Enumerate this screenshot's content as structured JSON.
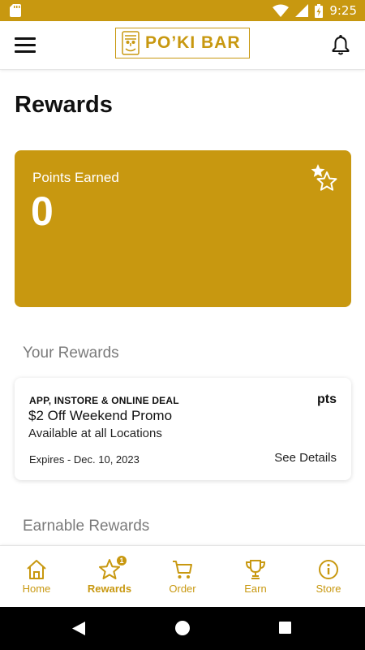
{
  "status_bar": {
    "time": "9:25",
    "battery_level": 0.75
  },
  "app_bar": {
    "logo_text": "PO’KI BAR",
    "menu_icon": "hamburger-menu-icon",
    "bell_icon": "bell-icon"
  },
  "page": {
    "title": "Rewards"
  },
  "points_card": {
    "label": "Points Earned",
    "value": "0",
    "icon": "stars-icon"
  },
  "sections": {
    "your_rewards": "Your Rewards",
    "earnable_rewards": "Earnable Rewards"
  },
  "rewards": [
    {
      "tag": "APP, INSTORE & ONLINE DEAL",
      "points": "pts",
      "title": "$2 Off Weekend Promo",
      "subtitle": "Available at all Locations",
      "expires": "Expires - Dec. 10, 2023",
      "details_label": "See Details"
    }
  ],
  "bottom_nav": {
    "items": [
      {
        "label": "Home",
        "icon": "home-icon"
      },
      {
        "label": "Rewards",
        "icon": "star-icon",
        "badge": "1",
        "active": true
      },
      {
        "label": "Order",
        "icon": "cart-icon"
      },
      {
        "label": "Earn",
        "icon": "trophy-icon"
      },
      {
        "label": "Store",
        "icon": "info-icon"
      }
    ]
  },
  "colors": {
    "brand": "#c89810",
    "text": "#111111",
    "muted": "#7a7a7a"
  }
}
